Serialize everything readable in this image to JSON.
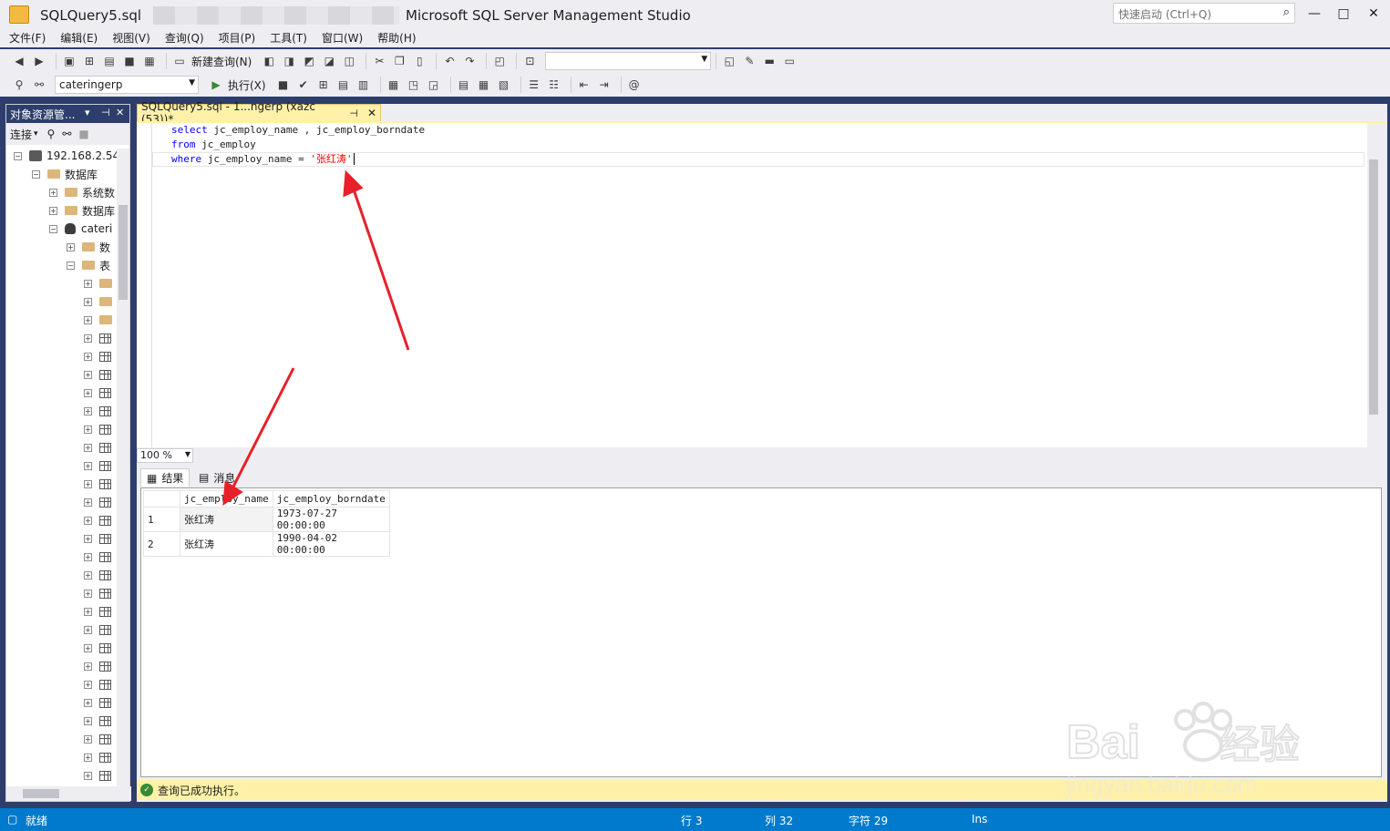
{
  "window": {
    "title_file": "SQLQuery5.sql",
    "title_app": "Microsoft SQL Server Management Studio",
    "quick_launch_placeholder": "快速启动 (Ctrl+Q)",
    "min": "—",
    "max": "□",
    "close": "✕"
  },
  "menu": [
    "文件(F)",
    "编辑(E)",
    "视图(V)",
    "查询(Q)",
    "项目(P)",
    "工具(T)",
    "窗口(W)",
    "帮助(H)"
  ],
  "toolbar": {
    "new_query": "新建查询(N)",
    "execute": "执行(X)",
    "database_combo": "cateringerp",
    "solution_combo": ""
  },
  "explorer": {
    "title": "对象资源管...",
    "connect": "连接",
    "server": "192.168.2.54",
    "databases": "数据库",
    "system_dbs": "系统数",
    "db_snapshots": "数据库",
    "db_catering": "cateri",
    "db_diagrams": "数",
    "tables": "表"
  },
  "editor": {
    "tab_label": "SQLQuery5.sql - 1...ngerp (xazc (53))*",
    "tab_pin": "⊣",
    "tab_close": "✕",
    "lines": [
      {
        "kw": "select",
        "rest": " jc_employ_name , jc_employ_borndate"
      },
      {
        "kw": "from",
        "rest": " jc_employ"
      },
      {
        "kw": "where",
        "rest": " jc_employ_name = ",
        "str": "'张红涛'"
      }
    ],
    "zoom": "100 %"
  },
  "results": {
    "tab_results": "结果",
    "tab_messages": "消息",
    "columns": [
      "",
      "jc_employ_name",
      "jc_employ_borndate"
    ],
    "rows": [
      [
        "1",
        "张红涛",
        "1973-07-27 00:00:00"
      ],
      [
        "2",
        "张红涛",
        "1990-04-02 00:00:00"
      ]
    ],
    "status": "查询已成功执行。"
  },
  "statusbar": {
    "ready": "就绪",
    "line": "行 3",
    "col": "列 32",
    "char": "字符 29",
    "mode": "Ins"
  },
  "watermark": {
    "logo": "Bai du 经验",
    "url": "jingyan.baidu.com"
  },
  "colors": {
    "accent": "#007acc",
    "tab_active": "#fff1a8",
    "frame": "#2d3e6c",
    "annotation_arrow": "#e8202a"
  }
}
